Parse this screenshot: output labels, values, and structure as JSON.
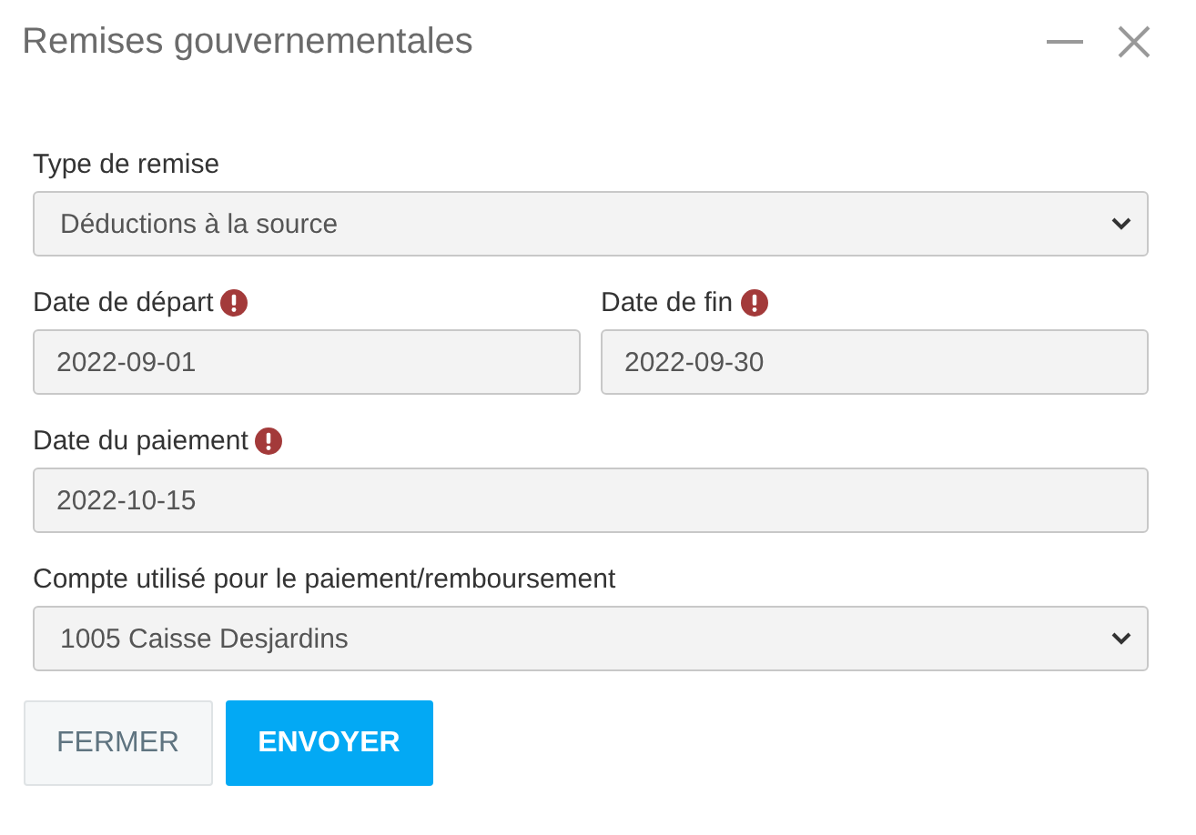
{
  "window": {
    "title": "Remises gouvernementales",
    "controls": [
      {
        "kind": "minimize"
      },
      {
        "kind": "close"
      }
    ]
  },
  "rows": [
    {
      "fields": [
        {
          "label": "Type de remise",
          "kind": "select",
          "value": "Déductions à la source",
          "required": false
        }
      ]
    },
    {
      "fields": [
        {
          "label": "Date de départ",
          "kind": "date",
          "value": "2022-09-01",
          "required": true
        },
        {
          "label": "Date de fin",
          "kind": "date",
          "value": "2022-09-30",
          "required": true
        }
      ]
    },
    {
      "fields": [
        {
          "label": "Date du paiement",
          "kind": "date",
          "value": "2022-10-15",
          "required": true
        }
      ]
    },
    {
      "fields": [
        {
          "label": "Compte utilisé pour le paiement/remboursement",
          "kind": "select",
          "value": "1005 Caisse Desjardins",
          "required": false
        }
      ]
    }
  ],
  "buttons": [
    {
      "label": "FERMER",
      "kind": "secondary"
    },
    {
      "label": "ENVOYER",
      "kind": "primary"
    }
  ]
}
